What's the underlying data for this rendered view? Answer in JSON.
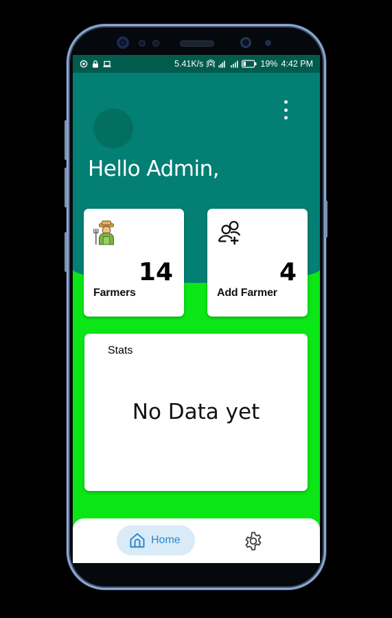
{
  "status_bar": {
    "speed": "5.41K/s",
    "battery": "19%",
    "time": "4:42 PM"
  },
  "header": {
    "greeting": "Hello Admin,"
  },
  "cards": {
    "farmers": {
      "count": "14",
      "label": "Farmers",
      "icon": "farmer-icon"
    },
    "add_farmer": {
      "count": "4",
      "label": "Add Farmer",
      "icon": "add-user-icon"
    }
  },
  "stats": {
    "title": "Stats",
    "empty_message": "No Data yet"
  },
  "bottom_nav": {
    "home_label": "Home",
    "home_icon": "home-icon",
    "settings_icon": "gear-icon",
    "active_color": "#2c86c8"
  },
  "colors": {
    "header": "#037f74",
    "status_bar": "#015c4d",
    "background": "#0be616",
    "avatar": "#036f60"
  }
}
